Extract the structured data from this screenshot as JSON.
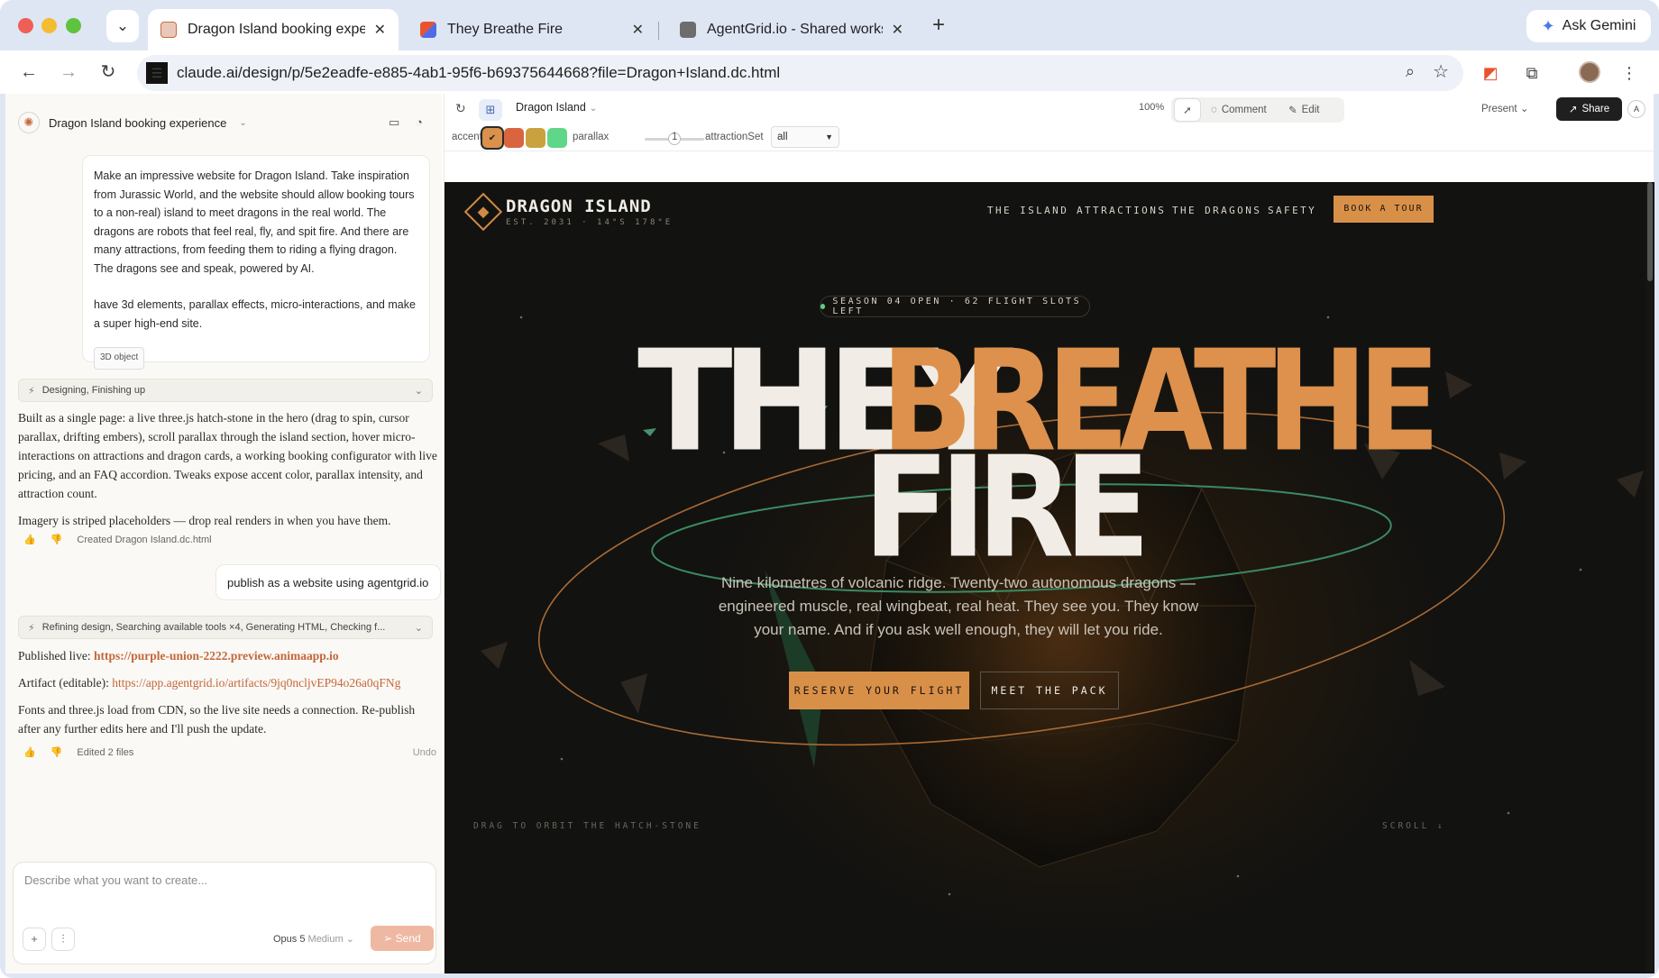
{
  "browser": {
    "tabs": [
      {
        "title": "Dragon Island booking experience",
        "active": true
      },
      {
        "title": "They Breathe Fire",
        "active": false
      },
      {
        "title": "AgentGrid.io - Shared workspace",
        "active": false
      }
    ],
    "new_tab": "+",
    "gemini_label": "Ask Gemini",
    "url": "claude.ai/design/p/5e2eadfe-e885-4ab1-95f6-b69375644668?file=Dragon+Island.dc.html"
  },
  "left_panel": {
    "project_title": "Dragon Island booking experience",
    "user_prompt_p1": "Make an impressive website for Dragon Island. Take inspiration from Jurassic World, and the website should allow booking tours to a non-real) island to meet dragons in the real world. The dragons are robots that feel real, fly, and spit fire. And there are many attractions, from feeding them to riding a flying dragon. The dragons see and speak, powered by AI.",
    "user_prompt_p2": "have 3d elements, parallax effects, micro-interactions, and make a super high-end site.",
    "prompt_chip": "3D object",
    "status1": "Designing, Finishing up",
    "reply1_p1": "Built as a single page: a live three.js hatch-stone in the hero (drag to spin, cursor parallax, drifting embers), scroll parallax through the island section, hover micro-interactions on attractions and dragon cards, a working booking configurator with live pricing, and an FAQ accordion. Tweaks expose accent color, parallax intensity, and attraction count.",
    "reply1_p2": "Imagery is striped placeholders — drop real renders in when you have them.",
    "action1": "Created Dragon Island.dc.html",
    "user_msg2": "publish as a website using agentgrid.io",
    "status2": "Refining design, Searching available tools ×4, Generating HTML, Checking f...",
    "published_label": "Published live:",
    "published_url": "https://purple-union-2222.preview.animaapp.io",
    "artifact_label": "Artifact (editable):",
    "artifact_url": "https://app.agentgrid.io/artifacts/9jq0ncljvEP94o26a0qFNg",
    "reply2_p2": "Fonts and three.js load from CDN, so the live site needs a connection. Re-publish after any further edits here and I'll push the update.",
    "action2": "Edited 2 files",
    "undo": "Undo",
    "composer_placeholder": "Describe what you want to create...",
    "model_name": "Opus 5",
    "model_effort": "Medium",
    "send_label": "Send"
  },
  "right_panel": {
    "file_name": "Dragon Island",
    "zoom": "100%",
    "comment_label": "Comment",
    "edit_label": "Edit",
    "present_label": "Present",
    "share_label": "Share",
    "avatar_letter": "A",
    "tweaks": {
      "accent_label": "accent",
      "accent_colors": [
        "#d9914b",
        "#d9643f",
        "#c9a23f",
        "#5fd68a"
      ],
      "accent_selected": 0,
      "parallax_label": "parallax",
      "parallax_value": "1",
      "attraction_label": "attractionSet",
      "attraction_value": "all"
    }
  },
  "site": {
    "brand": "DRAGON ISLAND",
    "brand_sub": "EST. 2031 · 14°S 178°E",
    "nav": [
      "THE ISLAND",
      "ATTRACTIONS",
      "THE DRAGONS",
      "SAFETY"
    ],
    "book_label": "BOOK A TOUR",
    "season_badge": "SEASON 04 OPEN · 62 FLIGHT SLOTS LEFT",
    "headline_1": "THEY",
    "headline_2": "BREATHE",
    "headline_3": "FIRE",
    "lede": "Nine kilometres of volcanic ridge. Twenty-two autonomous dragons — engineered muscle, real wingbeat, real heat. They see you. They know your name. And if you ask well enough, they will let you ride.",
    "cta_primary": "RESERVE YOUR FLIGHT",
    "cta_secondary": "MEET THE PACK",
    "hint": "DRAG TO ORBIT THE HATCH-STONE",
    "scroll": "SCROLL ↓",
    "accent": "#d89049",
    "status_dot": "#5fcf87"
  }
}
